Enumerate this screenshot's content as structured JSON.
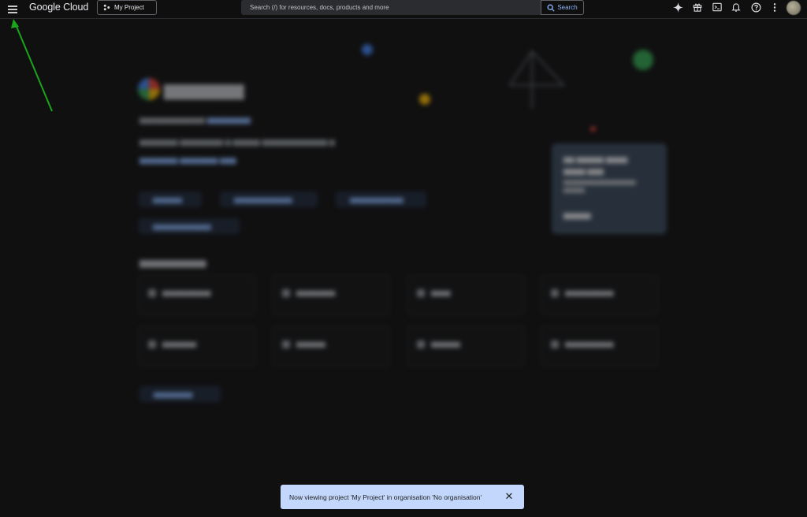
{
  "header": {
    "brand": "Google Cloud",
    "project_label": "My Project",
    "search_placeholder": "Search (/) for resources, docs, products and more",
    "search_button_label": "Search",
    "icons": [
      "menu-icon",
      "project-icon",
      "gemini-sparkle-icon",
      "gift-icon",
      "cloud-shell-icon",
      "notifications-bell-icon",
      "help-icon",
      "more-vert-icon",
      "search-icon"
    ]
  },
  "snackbar": {
    "message": "Now viewing project 'My Project' in organisation 'No organisation'",
    "close_icon": "close-icon"
  },
  "colors": {
    "accent": "#8ab4f8",
    "snackbar_bg": "#c2d7fb",
    "annotation_arrow": "#1aa51a"
  }
}
